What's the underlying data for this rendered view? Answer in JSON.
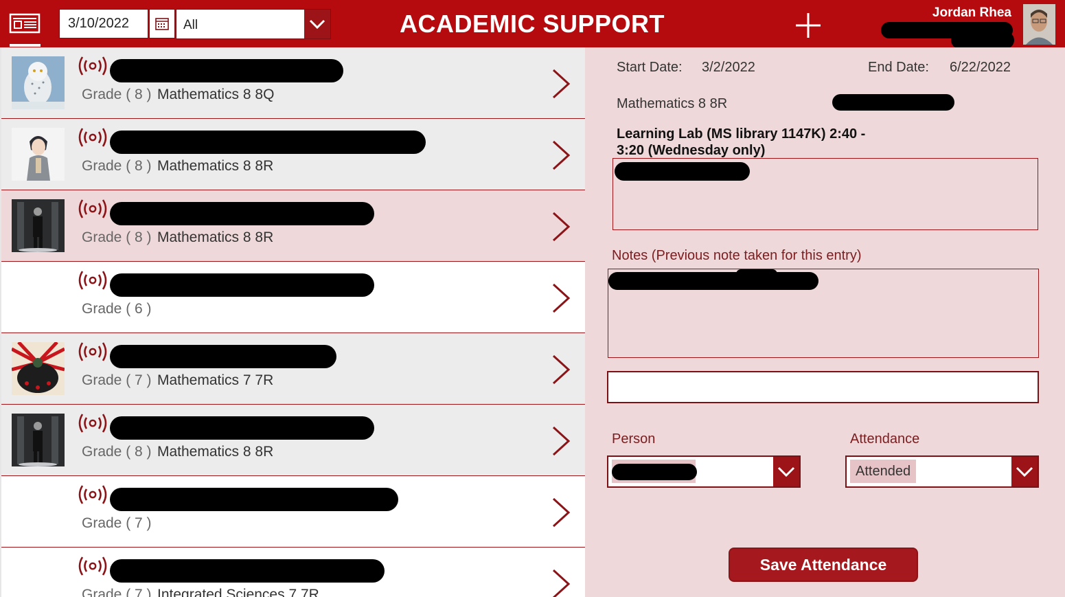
{
  "header": {
    "date_value": "3/10/2022",
    "filter_value": "All",
    "title": "ACADEMIC SUPPORT",
    "user_name": "Jordan Rhea",
    "icons": [
      "menu-icon",
      "calendar-icon",
      "chevron-down-icon",
      "plus-icon",
      "avatar"
    ]
  },
  "list": {
    "rows": [
      {
        "grade": "Grade ( 8 )",
        "course": "Mathematics 8 8Q",
        "thumb": "owl"
      },
      {
        "grade": "Grade ( 8 )",
        "course": "Mathematics 8 8R",
        "thumb": "anime"
      },
      {
        "grade": "Grade ( 8 )",
        "course": "Mathematics 8 8R",
        "thumb": "dark-figure"
      },
      {
        "grade": "Grade ( 6 )",
        "course": "",
        "thumb": ""
      },
      {
        "grade": "Grade ( 7 )",
        "course": "Mathematics 7 7R",
        "thumb": "red-poster"
      },
      {
        "grade": "Grade ( 8 )",
        "course": "Mathematics 8 8R",
        "thumb": "dark-figure"
      },
      {
        "grade": "Grade ( 7 )",
        "course": "",
        "thumb": ""
      },
      {
        "grade": "Grade ( 7 )",
        "course": "Integrated Sciences 7 7R",
        "thumb": ""
      }
    ]
  },
  "detail": {
    "start_label": "Start Date:",
    "start_value": "3/2/2022",
    "end_label": "End Date:",
    "end_value": "6/22/2022",
    "course": "Mathematics 8 8R",
    "session": "Learning Lab (MS library 1147K) 2:40 - 3:20 (Wednesday only)",
    "notes_label": "Notes (Previous note taken for this entry)",
    "person_label": "Person",
    "attendance_label": "Attendance",
    "attendance_value": "Attended",
    "save_label": "Save Attendance"
  },
  "colors": {
    "header": "#b50b0f",
    "accent": "#9c1418",
    "panel": "#efd8d9",
    "list": "#ececec"
  }
}
